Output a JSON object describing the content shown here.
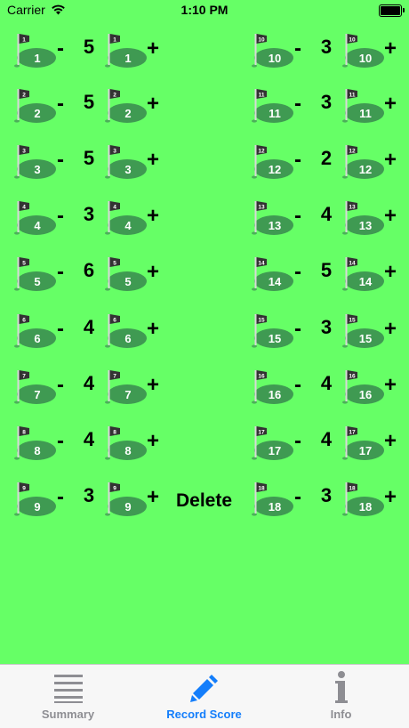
{
  "status_bar": {
    "carrier": "Carrier",
    "time": "1:10 PM"
  },
  "controls": {
    "minus": "-",
    "plus": "+",
    "delete_label": "Delete"
  },
  "holes": [
    {
      "number": "1",
      "score": "5"
    },
    {
      "number": "2",
      "score": "5"
    },
    {
      "number": "3",
      "score": "5"
    },
    {
      "number": "4",
      "score": "3"
    },
    {
      "number": "5",
      "score": "6"
    },
    {
      "number": "6",
      "score": "4"
    },
    {
      "number": "7",
      "score": "4"
    },
    {
      "number": "8",
      "score": "4"
    },
    {
      "number": "9",
      "score": "3"
    },
    {
      "number": "10",
      "score": "3"
    },
    {
      "number": "11",
      "score": "3"
    },
    {
      "number": "12",
      "score": "2"
    },
    {
      "number": "13",
      "score": "4"
    },
    {
      "number": "14",
      "score": "5"
    },
    {
      "number": "15",
      "score": "3"
    },
    {
      "number": "16",
      "score": "4"
    },
    {
      "number": "17",
      "score": "4"
    },
    {
      "number": "18",
      "score": "3"
    }
  ],
  "tabs": [
    {
      "label": "Summary",
      "icon": "list-icon",
      "active": false
    },
    {
      "label": "Record Score",
      "icon": "pencil-icon",
      "active": true
    },
    {
      "label": "Info",
      "icon": "info-icon",
      "active": false
    }
  ],
  "colors": {
    "background": "#66ff66",
    "flag_green": "#3f9a52",
    "tab_active": "#147efb",
    "tab_inactive": "#8e8e93"
  }
}
